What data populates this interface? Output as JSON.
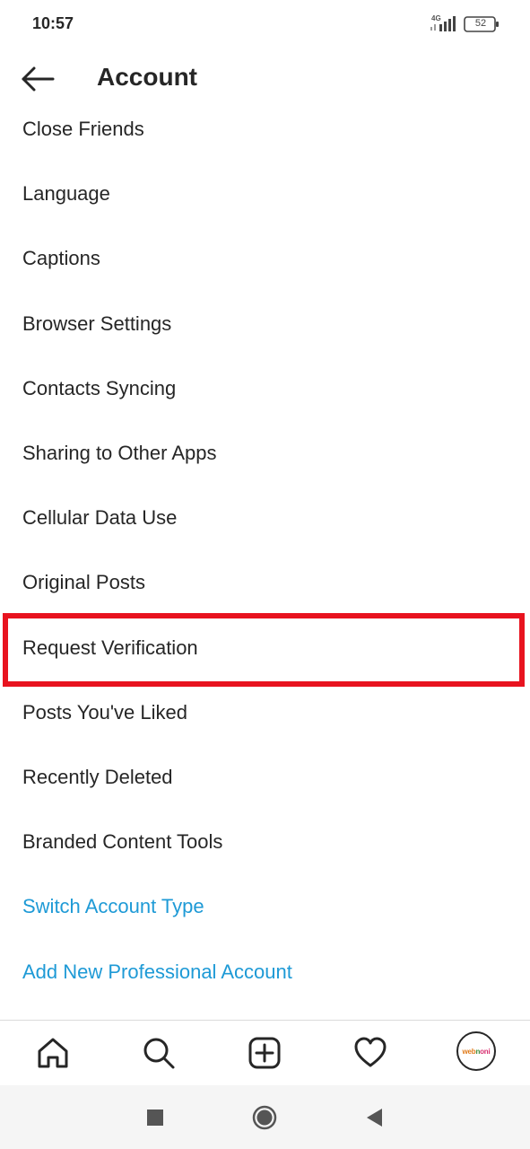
{
  "status_bar": {
    "time": "10:57",
    "network": "4G",
    "battery": "52"
  },
  "header": {
    "title": "Account"
  },
  "menu": [
    {
      "label": "Close Friends",
      "style": "normal"
    },
    {
      "label": "Language",
      "style": "normal"
    },
    {
      "label": "Captions",
      "style": "normal"
    },
    {
      "label": "Browser Settings",
      "style": "normal"
    },
    {
      "label": "Contacts Syncing",
      "style": "normal"
    },
    {
      "label": "Sharing to Other Apps",
      "style": "normal"
    },
    {
      "label": "Cellular Data Use",
      "style": "normal"
    },
    {
      "label": "Original Posts",
      "style": "normal"
    },
    {
      "label": "Request Verification",
      "style": "normal",
      "highlighted": true
    },
    {
      "label": "Posts You've Liked",
      "style": "normal"
    },
    {
      "label": "Recently Deleted",
      "style": "normal"
    },
    {
      "label": "Branded Content Tools",
      "style": "normal"
    },
    {
      "label": "Switch Account Type",
      "style": "link"
    },
    {
      "label": "Add New Professional Account",
      "style": "link"
    }
  ],
  "bottom_nav": {
    "items": [
      "home-icon",
      "search-icon",
      "new-post-icon",
      "activity-heart-icon",
      "profile-avatar"
    ],
    "avatar_text": [
      "web",
      "n",
      "oni"
    ]
  },
  "system_nav": {
    "items": [
      "recents-square-icon",
      "home-circle-icon",
      "back-triangle-icon"
    ]
  },
  "colors": {
    "text": "#262626",
    "link": "#1e9ad6",
    "highlight": "#e8131f",
    "divider": "#dbdbdb"
  }
}
